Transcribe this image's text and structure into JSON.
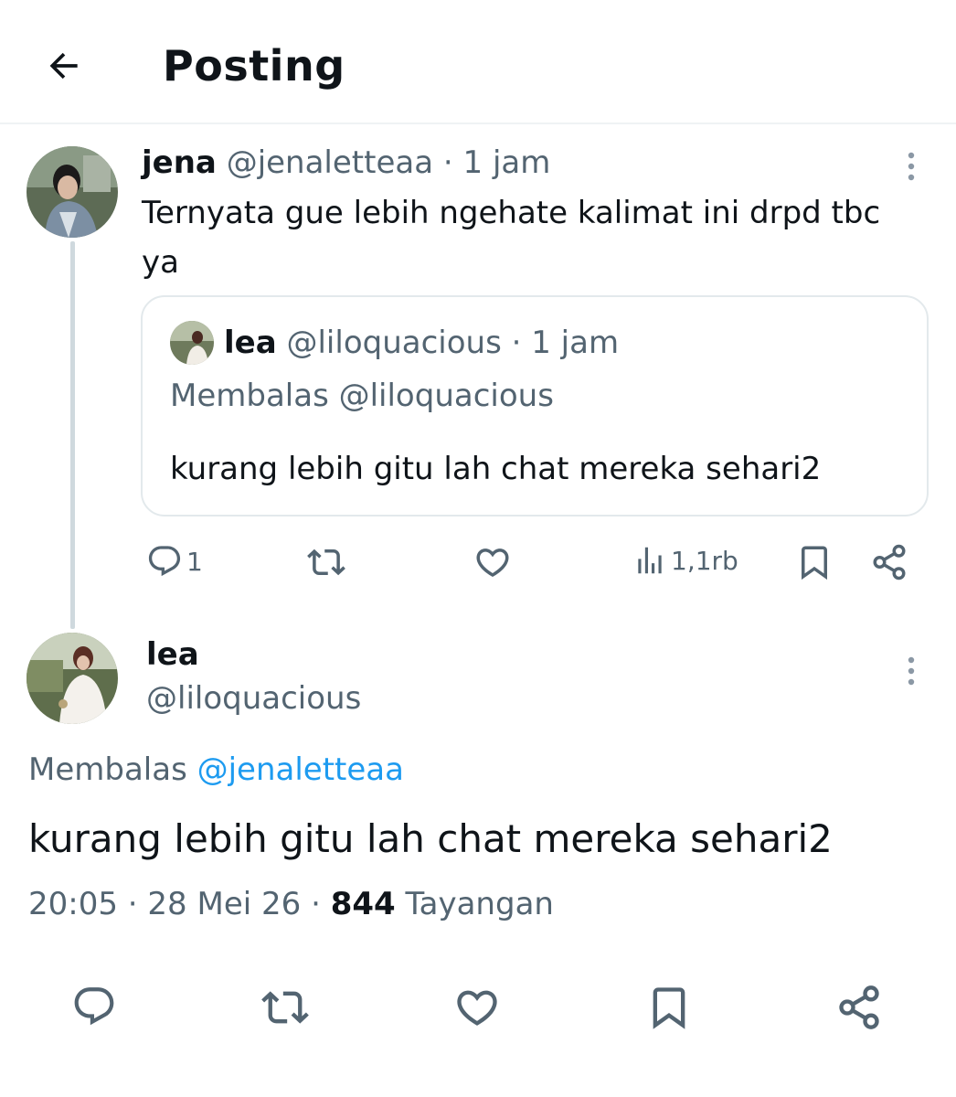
{
  "header": {
    "title": "Posting",
    "back_icon": "arrow-left-icon"
  },
  "parent_post": {
    "author_name": "jena",
    "author_handle": "@jenaletteaa",
    "separator": "·",
    "time_ago": "1 jam",
    "text": "Ternyata gue lebih ngehate kalimat ini drpd tbc ya",
    "quoted": {
      "author_name": "lea",
      "author_handle": "@liloquacious",
      "separator": "·",
      "time_ago": "1 jam",
      "reply_to": "Membalas @liloquacious",
      "text": "kurang lebih gitu lah chat mereka sehari2"
    },
    "actions": {
      "reply_count": "1",
      "views": "1,1rb"
    }
  },
  "main_post": {
    "author_name": "lea",
    "author_handle": "@liloquacious",
    "reply_prefix": "Membalas",
    "reply_link": "@jenaletteaa",
    "text": "kurang lebih gitu lah chat mereka sehari2",
    "time": "20:05",
    "sep1": "·",
    "date": "28 Mei 26",
    "sep2": "·",
    "view_count": "844",
    "view_label": "Tayangan"
  },
  "colors": {
    "text_primary": "#0f1419",
    "text_secondary": "#536471",
    "link": "#1d9bf0",
    "border": "#eff3f4"
  }
}
